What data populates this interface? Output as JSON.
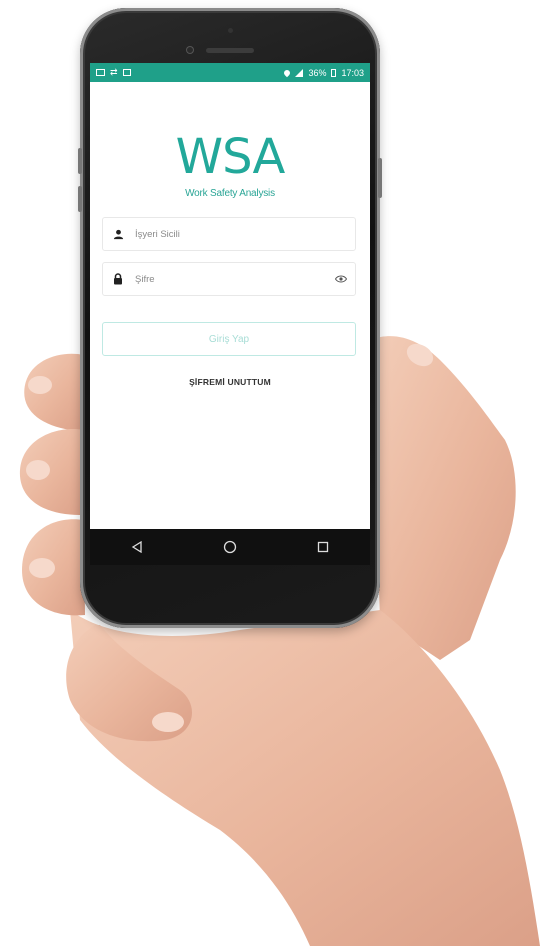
{
  "status_bar": {
    "battery": "36%",
    "time": "17:03",
    "left_icons": [
      "mail-icon",
      "cast-icon",
      "image-icon"
    ],
    "right_icons": [
      "location-icon",
      "signal-icon",
      "battery-icon"
    ],
    "background_color": "#1fa089"
  },
  "logo": {
    "title": "WSA",
    "subtitle": "Work Safety Analysis",
    "color": "#22a89a"
  },
  "form": {
    "employee_id": {
      "placeholder": "İşyeri Sicili",
      "value": "",
      "icon": "user-icon"
    },
    "password": {
      "placeholder": "Şifre",
      "value": "",
      "icon": "lock-icon",
      "toggle_icon": "eye-icon"
    },
    "login_label": "Giriş Yap",
    "forgot_label": "ŞİFREMİ UNUTTUM"
  },
  "nav_bar": {
    "buttons": [
      "back-icon",
      "home-icon",
      "recents-icon"
    ]
  }
}
